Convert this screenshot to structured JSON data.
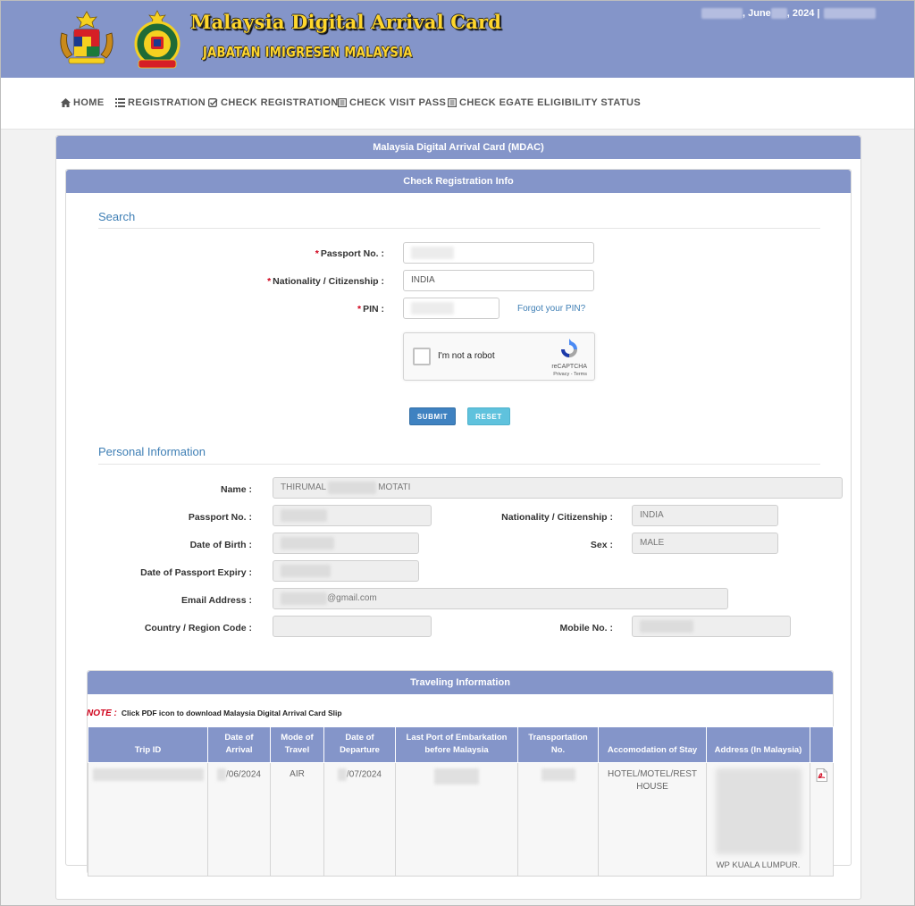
{
  "header": {
    "title": "Malaysia Digital Arrival Card",
    "subtitle": "JABATAN IMIGRESEN MALAYSIA",
    "date_month": ", June ",
    "date_year": ", 2024 |"
  },
  "nav": {
    "items": [
      {
        "label": "HOME",
        "icon": "home-icon"
      },
      {
        "label": "REGISTRATION",
        "icon": "list-icon"
      },
      {
        "label": "CHECK REGISTRATION",
        "icon": "check-square-icon"
      },
      {
        "label": "CHECK VISIT PASS",
        "icon": "form-icon"
      },
      {
        "label": "CHECK EGATE ELIGIBILITY STATUS",
        "icon": "form-icon"
      }
    ]
  },
  "panel": {
    "title": "Malaysia Digital Arrival Card (MDAC)",
    "inner_title": "Check Registration Info"
  },
  "search": {
    "section_title": "Search",
    "passport_label": "Passport No. :",
    "nationality_label": "Nationality / Citizenship :",
    "nationality_value": "INDIA",
    "pin_label": "PIN :",
    "forgot_pin": "Forgot your PIN?",
    "required_mark": "*",
    "captcha": {
      "text": "I'm not a robot",
      "brand": "reCAPTCHA",
      "terms": "Privacy - Terms"
    },
    "submit_label": "SUBMIT",
    "reset_label": "RESET"
  },
  "personal": {
    "section_title": "Personal Information",
    "name_label": "Name :",
    "name_first": "THIRUMAL",
    "name_last": "MOTATI",
    "passport_label": "Passport No. :",
    "nationality_label": "Nationality / Citizenship :",
    "nationality_value": "INDIA",
    "dob_label": "Date of Birth :",
    "sex_label": "Sex :",
    "sex_value": "MALE",
    "expiry_label": "Date of Passport Expiry :",
    "email_label": "Email Address :",
    "email_domain": "@gmail.com",
    "country_code_label": "Country / Region Code :",
    "mobile_label": "Mobile No. :"
  },
  "travel": {
    "title": "Traveling Information",
    "note_label": "NOTE :",
    "note_text": "Click PDF icon to download Malaysia Digital Arrival Card Slip",
    "columns": [
      "Trip ID",
      "Date of Arrival",
      "Mode of Travel",
      "Date of Departure",
      "Last Port of Embarkation before Malaysia",
      "Transportation No.",
      "Accomodation of Stay",
      "Address (In Malaysia)"
    ],
    "row": {
      "arrival": "/06/2024",
      "mode": "AIR",
      "departure": "/07/2024",
      "accommodation": "HOTEL/MOTEL/REST HOUSE",
      "address_city": "WP KUALA LUMPUR."
    }
  },
  "colors": {
    "header_bg": "#8495c9",
    "link": "#3f7fb5",
    "required": "#d0021b",
    "logo_text": "#ffd62b"
  }
}
